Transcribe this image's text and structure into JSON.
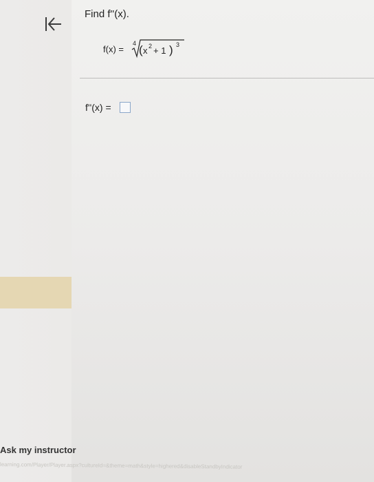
{
  "question": {
    "prompt": "Find f''(x).",
    "function_lhs": "f(x) =",
    "radical_index": "4",
    "inner_base": "x",
    "inner_exponent": "2",
    "inner_plus": "+ 1",
    "outer_exponent": "3",
    "answer_label": "f''(x) =",
    "answer_value": ""
  },
  "footer": {
    "ask_instructor": "Ask my instructor",
    "url": "learning.com/Player/Player.aspx?cultureId=&theme=math&style=highered&disableStandbyIndicator"
  },
  "icons": {
    "back": "arrow-left-bar-icon"
  },
  "colors": {
    "answer_box_border": "#8aa6c9",
    "highlight_strip": "#e5d7b3"
  }
}
